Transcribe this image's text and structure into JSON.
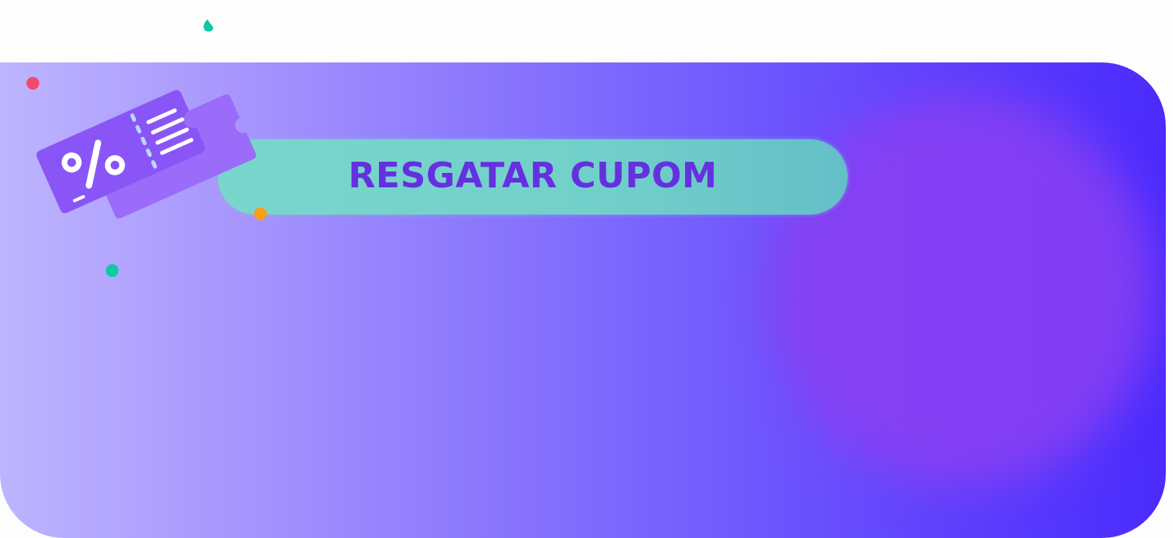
{
  "redeem": {
    "label": "RESGATAR CUPOM"
  },
  "coupon_illustration": {
    "icon": "coupon-ticket-icon",
    "symbol": "%"
  },
  "colors": {
    "gradient_start": "#bdb5fe",
    "gradient_end": "#4b2bfd",
    "button_bg": "#74d2ca",
    "button_text": "#6530e0",
    "ticket_front": "#8a55f7",
    "ticket_back": "#9b6bf9",
    "confetti_red": "#f44a6b",
    "confetti_teal": "#10c7a6",
    "confetti_orange": "#f5a017"
  }
}
